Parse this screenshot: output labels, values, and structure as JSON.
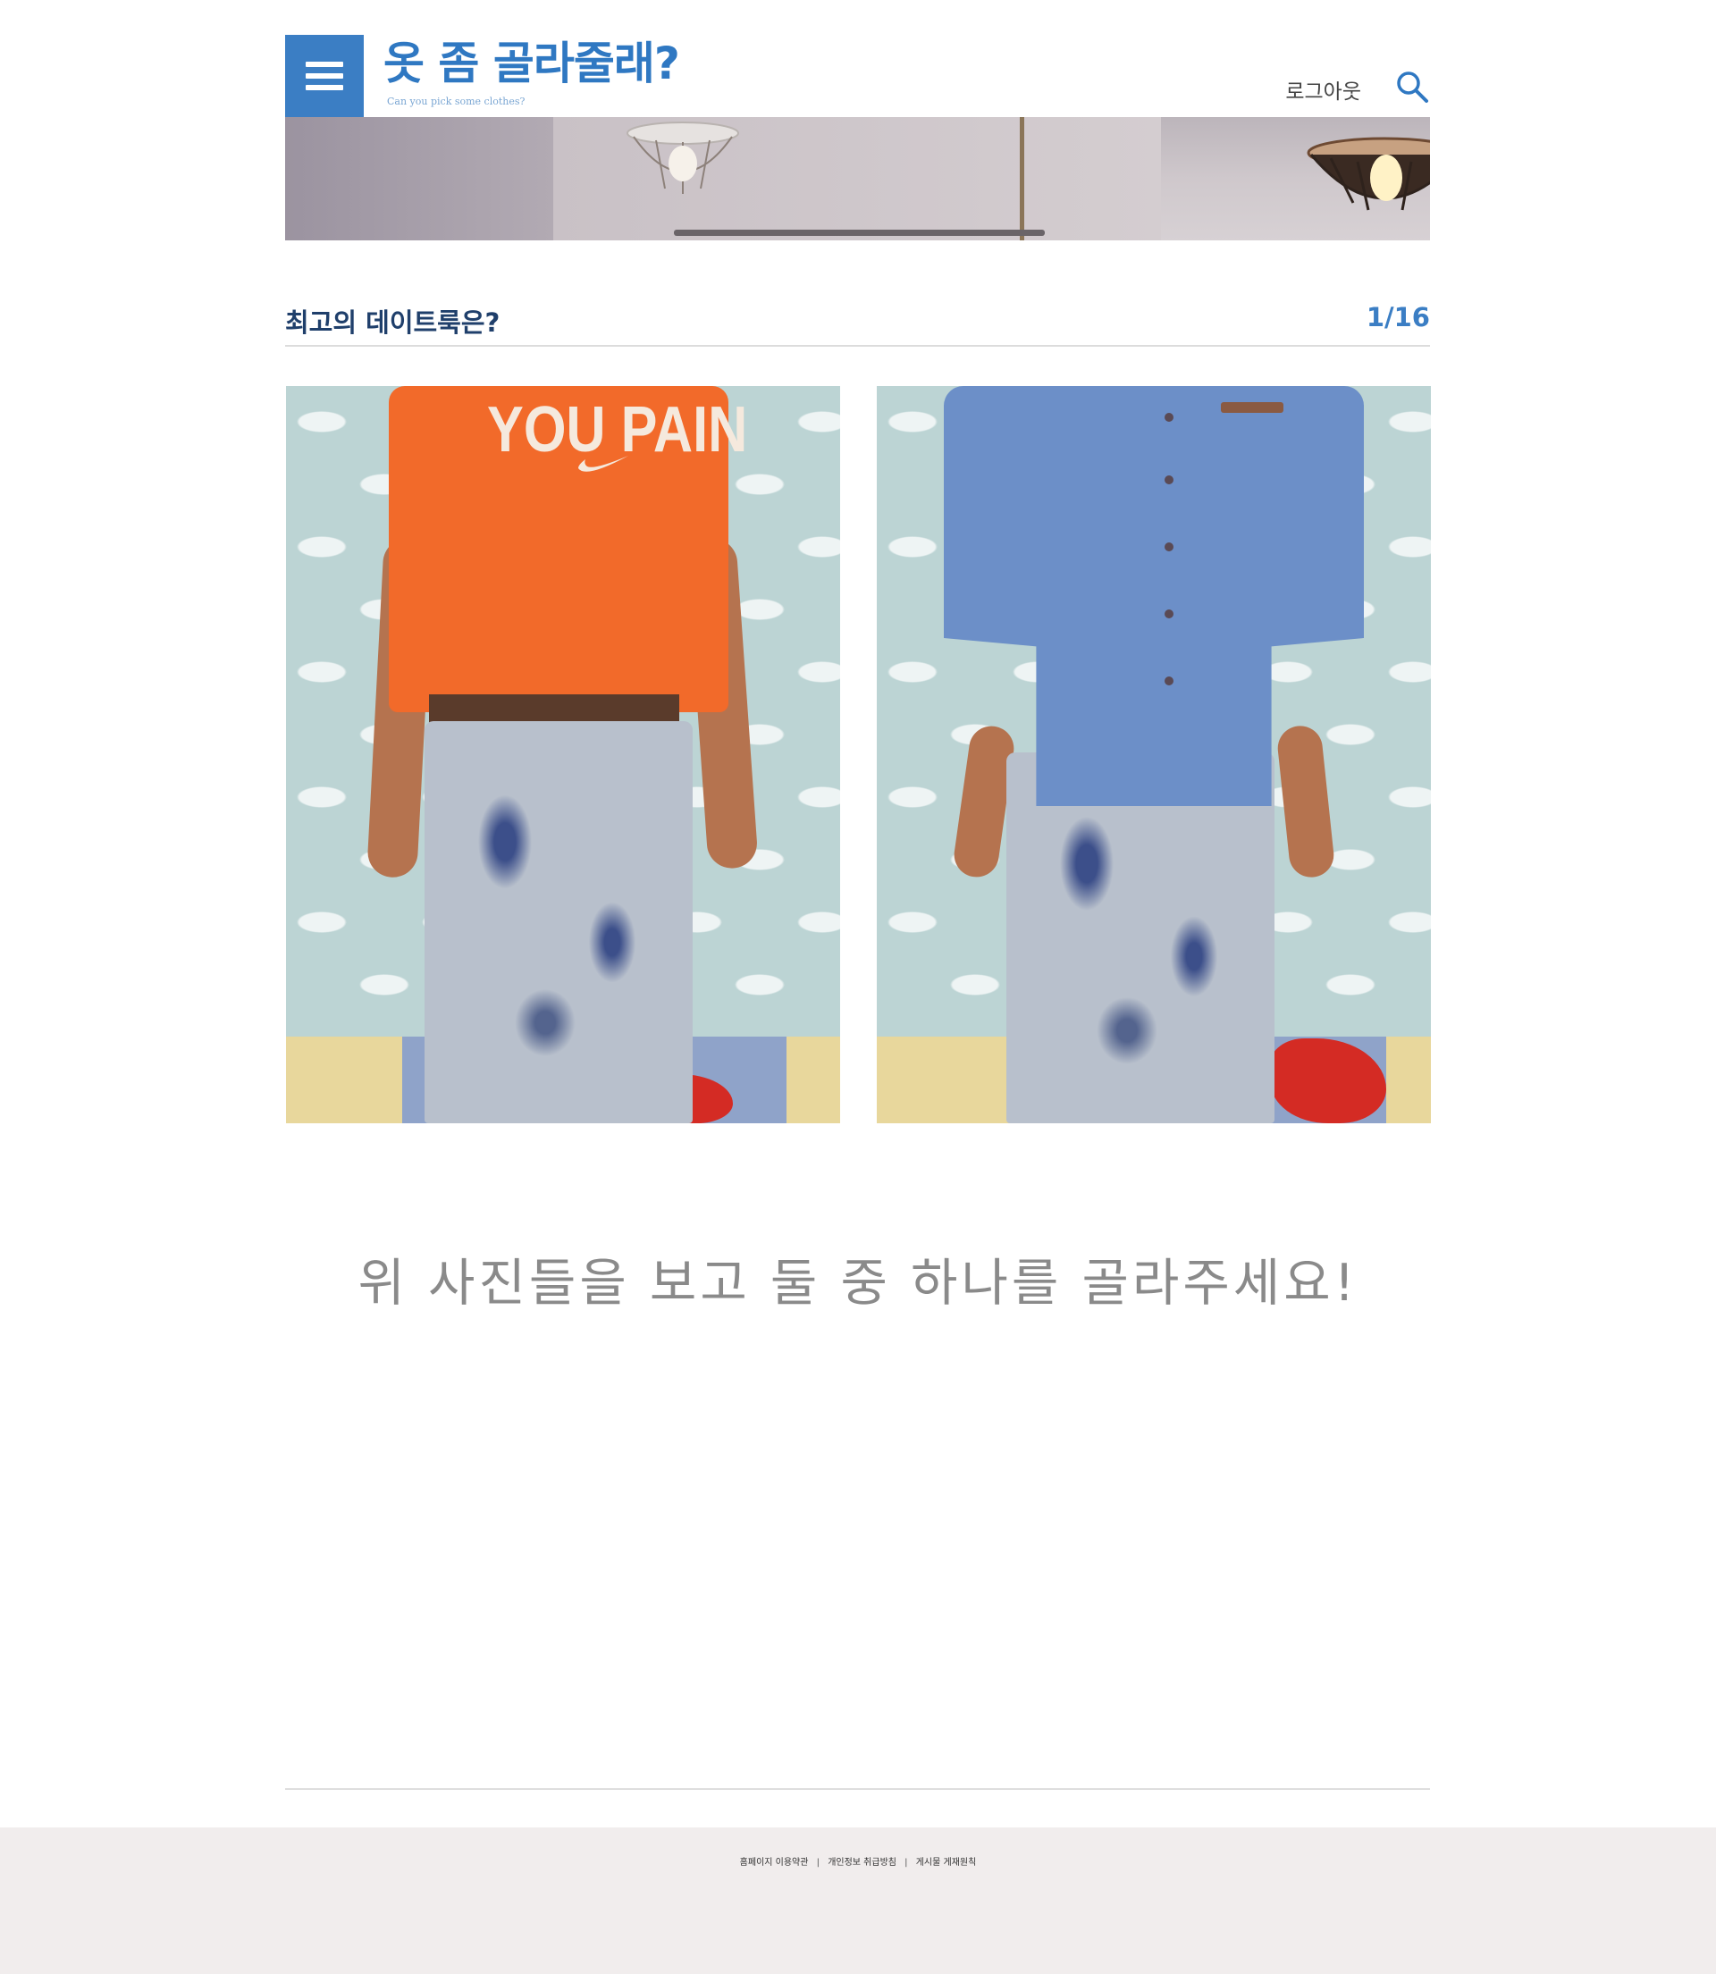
{
  "header": {
    "logo_title": "옷 좀 골라줄래?",
    "logo_subtitle": "Can you pick some clothes?",
    "logout_label": "로그아웃",
    "menu_icon": "hamburger-menu-icon",
    "search_icon": "search-icon"
  },
  "question": {
    "title": "최고의 데이트룩은?",
    "progress": "1/16"
  },
  "photos": {
    "left": {
      "print_text": "YOU PAIN"
    },
    "right": {
      "print_text": ""
    }
  },
  "instruction": "위 사진들을 보고 둘 중 하나를 골라주세요!",
  "footer": {
    "links": [
      "홈페이지 이용약관",
      "개인정보 취급방침",
      "게시물 게재원칙"
    ]
  },
  "colors": {
    "brand": "#3b7ec4",
    "title_dark": "#1f3f6b",
    "footer_bg": "#f1eded"
  }
}
